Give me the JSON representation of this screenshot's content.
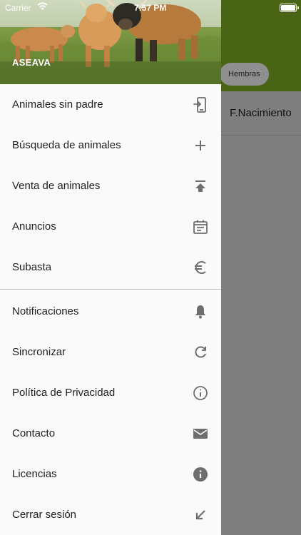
{
  "status_bar": {
    "carrier": "Carrier",
    "time": "7:57 PM"
  },
  "drawer": {
    "title": "ASEAVA"
  },
  "background": {
    "chip_label": "Hembras",
    "column_header": "F.Nacimiento"
  },
  "menu_primary": [
    {
      "label": "Animales sin padre",
      "icon": "phone-import-icon"
    },
    {
      "label": "Búsqueda de animales",
      "icon": "plus-icon"
    },
    {
      "label": "Venta de animales",
      "icon": "upload-icon"
    },
    {
      "label": "Anuncios",
      "icon": "calendar-icon"
    },
    {
      "label": "Subasta",
      "icon": "euro-icon"
    }
  ],
  "menu_secondary": [
    {
      "label": "Notificaciones",
      "icon": "bell-icon"
    },
    {
      "label": "Sincronizar",
      "icon": "refresh-icon"
    },
    {
      "label": "Política de Privacidad",
      "icon": "info-outline-icon"
    },
    {
      "label": "Contacto",
      "icon": "mail-icon"
    },
    {
      "label": "Licencias",
      "icon": "info-filled-icon"
    },
    {
      "label": "Cerrar sesión",
      "icon": "arrow-down-left-icon"
    }
  ],
  "colors": {
    "header_green": "#4a6416",
    "icon_gray": "#6e6e6e",
    "drawer_bg": "#fafafa",
    "scrim": "#7f7f7f"
  }
}
